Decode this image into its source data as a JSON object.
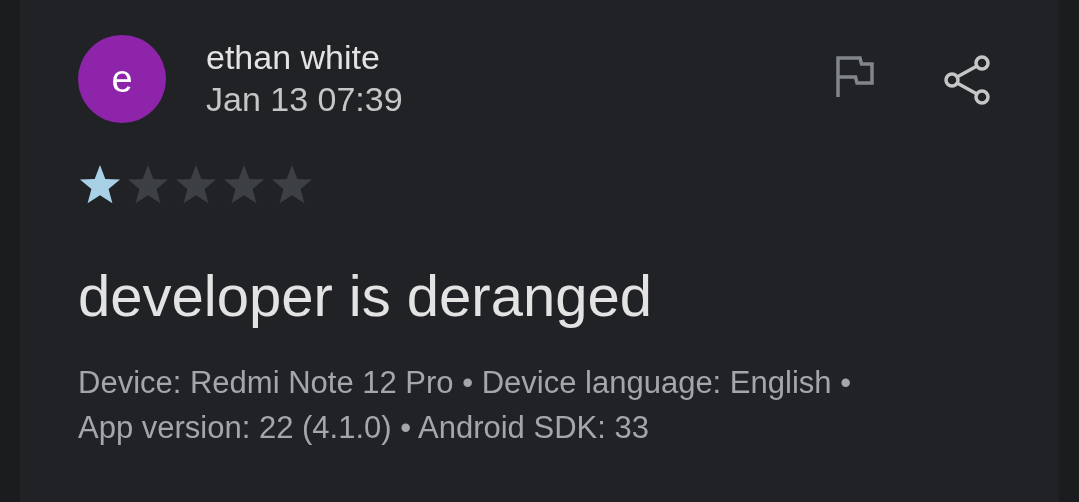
{
  "review": {
    "avatar_letter": "e",
    "author": "ethan white",
    "date": "Jan 13 07:39",
    "stars": 1,
    "title": "developer is deranged",
    "details": "Device: Redmi Note 12 Pro • Device language: English • App version: 22 (4.1.0) • Android SDK: 33"
  }
}
